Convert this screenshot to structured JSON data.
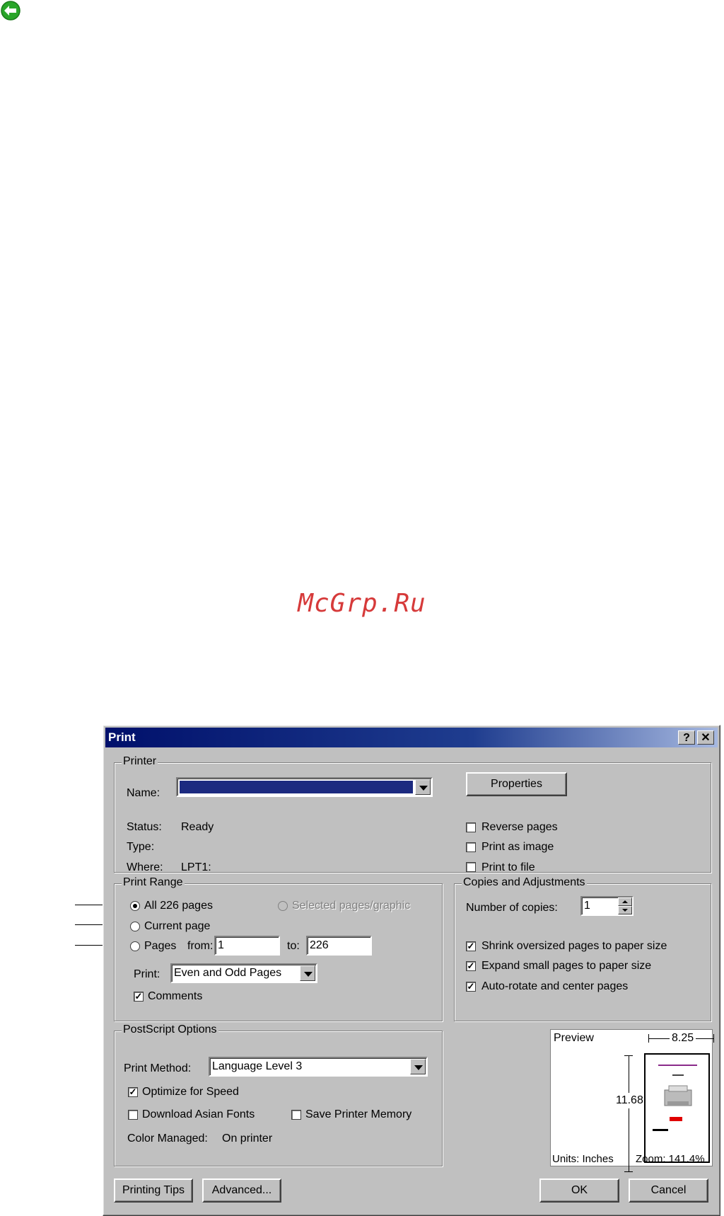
{
  "watermark": "McGrp.Ru",
  "dialog": {
    "title": "Print",
    "help_label": "?",
    "close_label": "✕",
    "printer": {
      "group_label": "Printer",
      "name_label": "Name:",
      "properties_label": "Properties",
      "status_label": "Status:",
      "status_value": "Ready",
      "type_label": "Type:",
      "type_value": "",
      "where_label": "Where:",
      "where_value": "LPT1:",
      "reverse_pages": {
        "label": "Reverse pages",
        "checked": false
      },
      "print_as_image": {
        "label": "Print as image",
        "checked": false
      },
      "print_to_file": {
        "label": "Print to file",
        "checked": false
      }
    },
    "print_range": {
      "group_label": "Print Range",
      "all_pages_label": "All 226 pages",
      "selected_label": "Selected pages/graphic",
      "current_page_label": "Current page",
      "pages_label": "Pages",
      "from_label": "from:",
      "from_value": "1",
      "to_label": "to:",
      "to_value": "226",
      "print_label": "Print:",
      "print_value": "Even and Odd Pages",
      "comments": {
        "label": "Comments",
        "checked": true
      }
    },
    "copies": {
      "group_label": "Copies and Adjustments",
      "number_label": "Number of copies:",
      "number_value": "1",
      "shrink": {
        "label": "Shrink oversized pages to paper size",
        "checked": true
      },
      "expand": {
        "label": "Expand small pages to paper size",
        "checked": true
      },
      "autorotate": {
        "label": "Auto-rotate and center pages",
        "checked": true
      }
    },
    "postscript": {
      "group_label": "PostScript Options",
      "method_label": "Print Method:",
      "method_value": "Language Level 3",
      "optimize": {
        "label": "Optimize for Speed",
        "checked": true
      },
      "download_fonts": {
        "label": "Download Asian Fonts",
        "checked": false
      },
      "save_memory": {
        "label": "Save Printer Memory",
        "checked": false
      },
      "color_managed_label": "Color Managed:",
      "color_managed_value": "On printer"
    },
    "preview": {
      "label": "Preview",
      "width": "8.25",
      "height": "11.68",
      "units_label": "Units: Inches",
      "zoom_label": "Zoom: 141.4%"
    },
    "buttons": {
      "printing_tips": "Printing Tips",
      "advanced": "Advanced...",
      "ok": "OK",
      "cancel": "Cancel"
    }
  },
  "colors": {
    "titlebar": "#00106b",
    "dialog_bg": "#c0c0c0",
    "watermark": "#d63a3a",
    "back_icon": "#2aa52a"
  }
}
